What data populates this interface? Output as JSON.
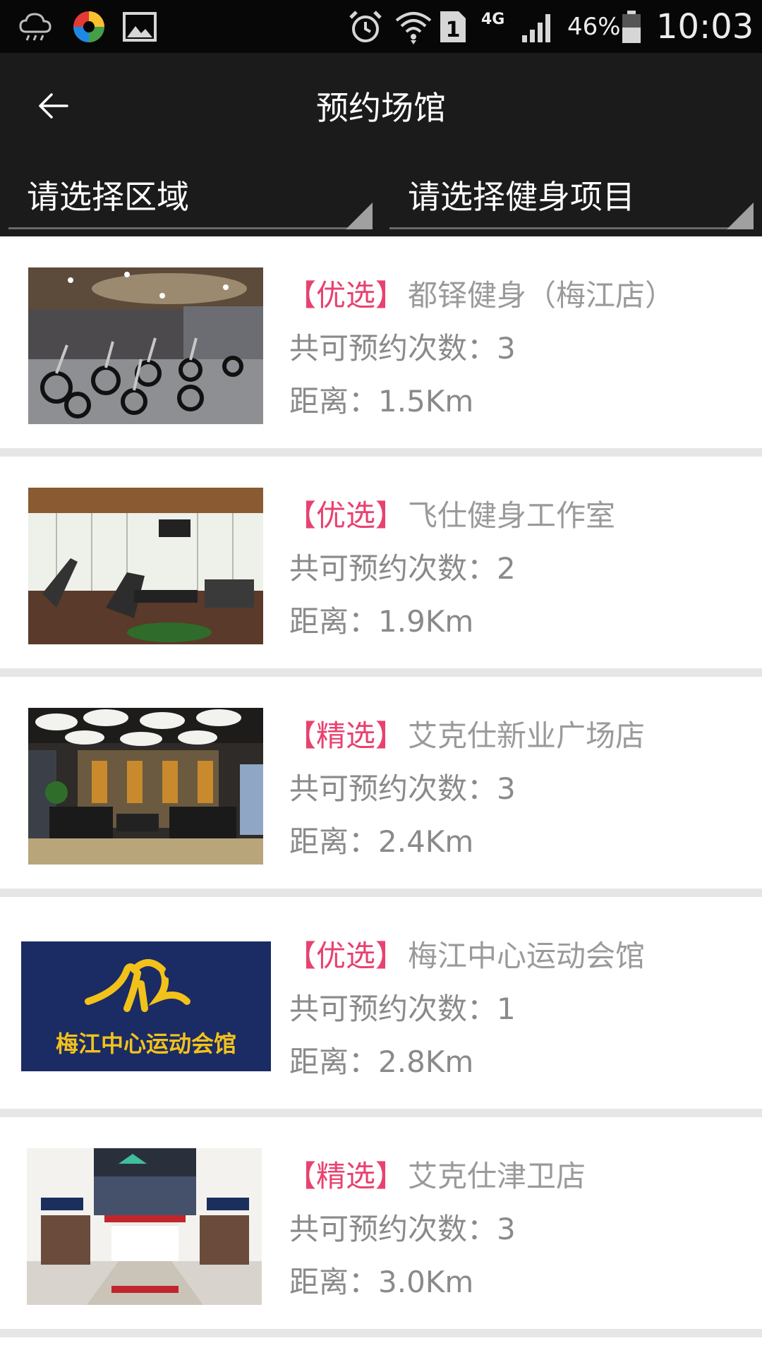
{
  "status_bar": {
    "battery": "46%",
    "time": "10:03",
    "network": "4G",
    "sim_slot": "1",
    "icons": [
      "weather-cloud-icon",
      "app-logo-icon",
      "gallery-icon",
      "alarm-icon",
      "wifi-icon",
      "sim-icon",
      "signal-icon",
      "battery-icon"
    ]
  },
  "header": {
    "title": "预约场馆",
    "back_icon": "arrow-left-icon"
  },
  "filters": {
    "region_label": "请选择区域",
    "project_label": "请选择健身项目"
  },
  "venues": [
    {
      "tag": "【优选】",
      "name": "都铎健身（梅江店）",
      "count": "共可预约次数：3",
      "distance": "距离：1.5Km",
      "image": "spin-bikes-photo"
    },
    {
      "tag": "【优选】",
      "name": "飞仕健身工作室",
      "count": "共可预约次数：2",
      "distance": "距离：1.9Km",
      "image": "treadmill-room-photo"
    },
    {
      "tag": "【精选】",
      "name": "艾克仕新业广场店",
      "count": "共可预约次数：3",
      "distance": "距离：2.4Km",
      "image": "lounge-photo"
    },
    {
      "tag": "【优选】",
      "name": "梅江中心运动会馆",
      "count": "共可预约次数：1",
      "distance": "距离：2.8Km",
      "image": "meijiang-logo",
      "logo_text": "梅江中心运动会馆"
    },
    {
      "tag": "【精选】",
      "name": "艾克仕津卫店",
      "count": "共可预约次数：3",
      "distance": "距离：3.0Km",
      "image": "gym-entrance-photo"
    }
  ],
  "colors": {
    "status_bg": "#070707",
    "header_bg": "#1b1b1b",
    "tag_pink": "#e8426f",
    "name_gray": "#9a9a9a",
    "divider": "#e6e6e6",
    "logo_blue": "#1b2b63",
    "logo_yellow": "#f2c21b"
  }
}
